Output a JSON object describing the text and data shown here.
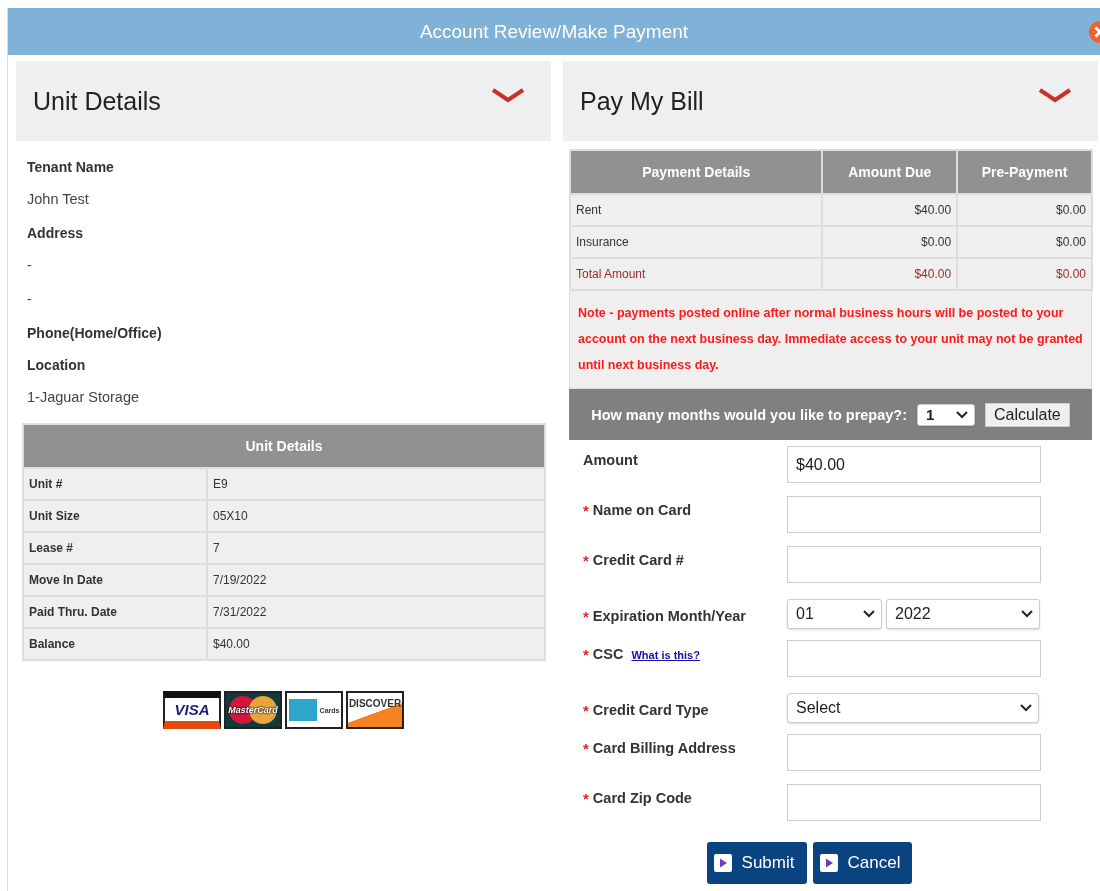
{
  "dialog": {
    "title": "Account Review/Make Payment"
  },
  "unit_panel": {
    "title": "Unit Details",
    "expanded": true,
    "info": [
      {
        "label": "Tenant Name",
        "values": [
          "John Test"
        ]
      },
      {
        "label": "Address",
        "values": [
          "-",
          "-"
        ]
      },
      {
        "label": "Phone(Home/Office)"
      },
      {
        "label": "Location",
        "values": [
          "1-Jaguar Storage"
        ]
      }
    ],
    "table": {
      "title": "Unit Details",
      "rows": [
        {
          "label": "Unit #",
          "value": "E9"
        },
        {
          "label": "Unit Size",
          "value": "05X10"
        },
        {
          "label": "Lease #",
          "value": "7"
        },
        {
          "label": "Move In Date",
          "value": "7/19/2022"
        },
        {
          "label": "Paid Thru. Date",
          "value": "7/31/2022"
        },
        {
          "label": "Balance",
          "value": "$40.00"
        }
      ]
    },
    "card_logos": [
      {
        "kind": "visa",
        "label": "VISA"
      },
      {
        "kind": "mastercard",
        "label": "MasterCard"
      },
      {
        "kind": "amex",
        "label": "Cards"
      },
      {
        "kind": "discover",
        "label": "DISCOVER"
      }
    ]
  },
  "bill_panel": {
    "title": "Pay My Bill",
    "expanded": true,
    "table": {
      "columns": [
        "Payment Details",
        "Amount Due",
        "Pre-Payment"
      ],
      "rows": [
        {
          "kind": "item",
          "cells": [
            "Rent",
            "$40.00",
            "$0.00"
          ]
        },
        {
          "kind": "item",
          "cells": [
            "Insurance",
            "$0.00",
            "$0.00"
          ]
        },
        {
          "kind": "total",
          "cells": [
            "Total Amount",
            "$40.00",
            "$0.00"
          ]
        }
      ]
    },
    "note": "Note - payments posted online after normal business hours will be posted to your account on the next business day. Immediate access to your unit may not be granted until next business day.",
    "prepay": {
      "label": "How many months would you like to prepay?:",
      "value": "1",
      "button": "Calculate"
    },
    "form": [
      {
        "kind": "input",
        "label": "Amount",
        "required": false,
        "value": "$40.00"
      },
      {
        "kind": "input",
        "label": "Name on  Card",
        "required": true
      },
      {
        "kind": "input",
        "label": "Credit Card #",
        "required": true
      },
      {
        "kind": "double-select",
        "label": "Expiration Month/Year",
        "required": true,
        "values": [
          "01",
          "2022"
        ]
      },
      {
        "kind": "input",
        "label": "CSC",
        "required": true,
        "link": "What is this?"
      },
      {
        "kind": "select",
        "label": "Credit Card Type",
        "required": true,
        "value": "Select"
      },
      {
        "kind": "input",
        "label": "Card Billing Address",
        "required": true
      },
      {
        "kind": "input",
        "label": "Card Zip Code",
        "required": true
      }
    ],
    "required_mark": "*",
    "buttons": [
      "Submit",
      "Cancel"
    ]
  }
}
